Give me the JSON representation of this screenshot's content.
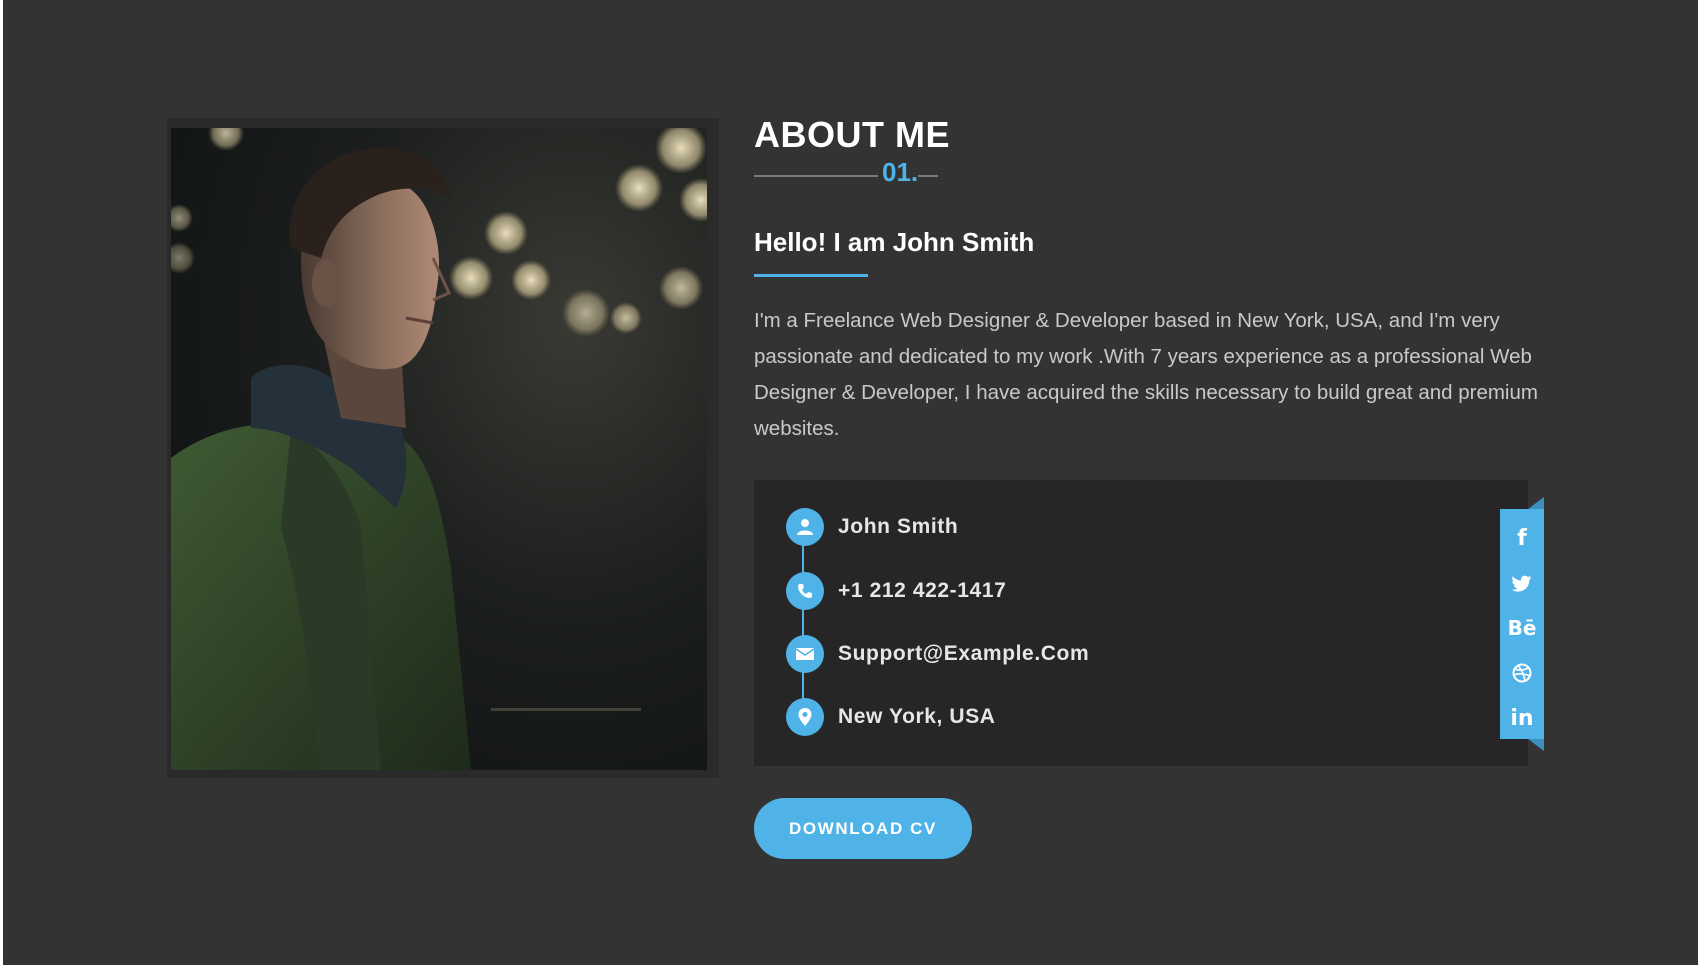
{
  "section": {
    "title": "ABOUT ME",
    "number": "01."
  },
  "intro": {
    "heading": "Hello! I am John Smith",
    "bio": "I'm a Freelance Web Designer & Developer based in New York, USA, and I'm very passionate and dedicated to my work .With 7 years experience as a professional Web Designer & Developer, I have acquired the skills necessary to build great and premium websites."
  },
  "info": {
    "items": [
      {
        "icon": "user-icon",
        "text": "John Smith"
      },
      {
        "icon": "phone-icon",
        "text": "+1 212 422-1417"
      },
      {
        "icon": "envelope-icon",
        "text": "Support@Example.Com"
      },
      {
        "icon": "map-pin-icon",
        "text": "New York, USA"
      }
    ]
  },
  "social": {
    "items": [
      {
        "icon": "facebook-icon",
        "glyph": "f"
      },
      {
        "icon": "twitter-icon",
        "glyph": ""
      },
      {
        "icon": "behance-icon",
        "glyph": "Bē"
      },
      {
        "icon": "dribbble-icon",
        "glyph": ""
      },
      {
        "icon": "linkedin-icon",
        "glyph": "in"
      }
    ]
  },
  "actions": {
    "download_label": "DOWNLOAD CV"
  },
  "colors": {
    "accent": "#4fb3e8",
    "background": "#333333",
    "card": "#262626"
  }
}
